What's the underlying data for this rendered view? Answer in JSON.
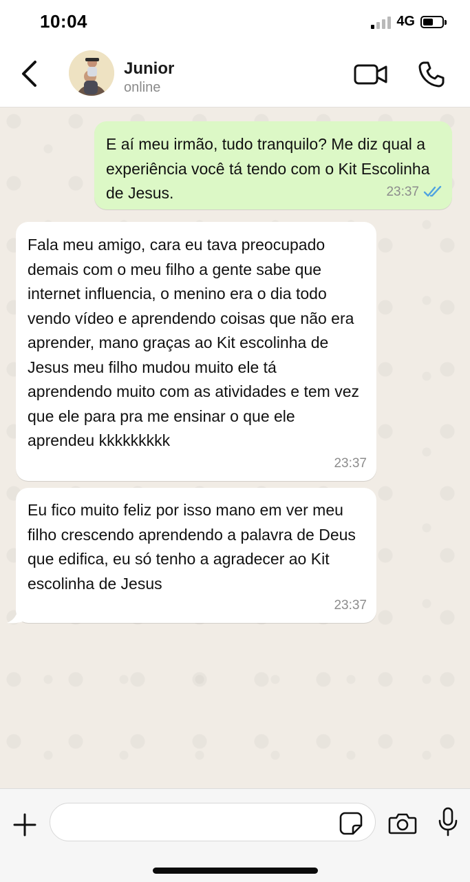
{
  "status_bar": {
    "time": "10:04",
    "network": "4G",
    "battery_level": 0.55,
    "signal_bars_active": 1
  },
  "header": {
    "contact_name": "Junior",
    "contact_status": "online",
    "icons": {
      "back": "chevron-left-icon",
      "video": "video-camera-icon",
      "call": "phone-icon"
    }
  },
  "messages": [
    {
      "direction": "outgoing",
      "text": "E aí meu irmão, tudo tranquilo? Me diz qual a experiência você tá tendo com o Kit Escolinha de Jesus.",
      "time": "23:37",
      "read_status": "double-check-blue"
    },
    {
      "direction": "incoming",
      "text": "Fala meu amigo, cara eu tava preocupado demais com o meu filho a gente sabe que internet influencia, o menino era o dia todo vendo vídeo e aprendendo coisas que não era aprender, mano graças ao Kit escolinha de Jesus meu filho mudou muito ele tá aprendendo muito com as atividades e tem vez que ele para pra me ensinar o que ele aprendeu kkkkkkkkk",
      "time": "23:37"
    },
    {
      "direction": "incoming",
      "text": "Eu fico muito feliz por isso mano em ver meu filho crescendo aprendendo a palavra de Deus que edifica, eu só tenho a agradecer ao Kit escolinha de Jesus",
      "time": "23:37"
    }
  ],
  "input_bar": {
    "value": "",
    "placeholder": "",
    "icons": {
      "attach": "plus-icon",
      "sticker": "sticker-icon",
      "camera": "camera-icon",
      "mic": "microphone-icon"
    }
  },
  "colors": {
    "outgoing_bubble": "#dcf8c6",
    "incoming_bubble": "#ffffff",
    "read_tick": "#4fa3e0",
    "chat_background": "#f1ece5"
  }
}
